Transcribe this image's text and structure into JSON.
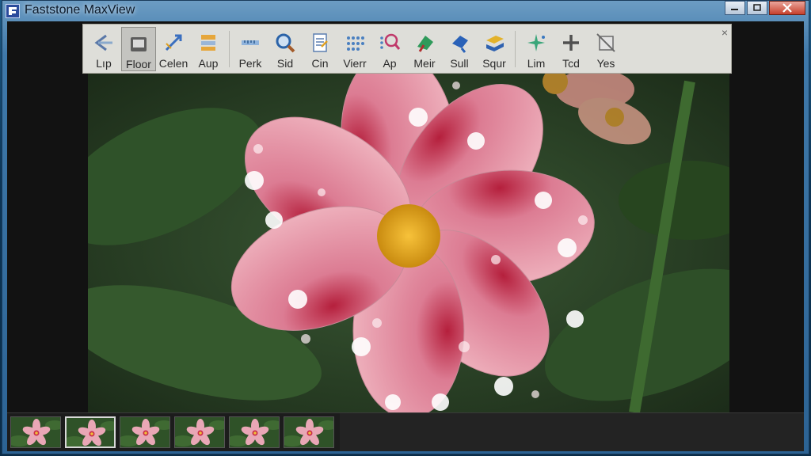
{
  "window": {
    "title": "Faststone MaxView"
  },
  "toolbar": {
    "tools": [
      {
        "label": "Lıp",
        "icon": "back-arrow-icon"
      },
      {
        "label": "Floor",
        "icon": "folder-icon"
      },
      {
        "label": "Celen",
        "icon": "draw-arrow-icon"
      },
      {
        "label": "Aup",
        "icon": "layout-icon"
      },
      {
        "label": "Perk",
        "icon": "ruler-icon"
      },
      {
        "label": "Sid",
        "icon": "magnifier-icon"
      },
      {
        "label": "Cin",
        "icon": "document-icon"
      },
      {
        "label": "Vierr",
        "icon": "grid-dots-icon"
      },
      {
        "label": "Ap",
        "icon": "zoom-dots-icon"
      },
      {
        "label": "Meir",
        "icon": "green-shape-icon"
      },
      {
        "label": "Sull",
        "icon": "blue-shape-icon"
      },
      {
        "label": "Squr",
        "icon": "layers-icon"
      },
      {
        "label": "Lim",
        "icon": "sparkle-icon"
      },
      {
        "label": "Tcd",
        "icon": "plus-icon"
      },
      {
        "label": "Yes",
        "icon": "crop-icon"
      }
    ],
    "close_label": "×"
  },
  "thumbnails": {
    "count": 6,
    "selected_index": 1
  },
  "colors": {
    "accent": "#2c6394",
    "petal": "#e8a3b2",
    "leaf": "#2f4f2a"
  }
}
